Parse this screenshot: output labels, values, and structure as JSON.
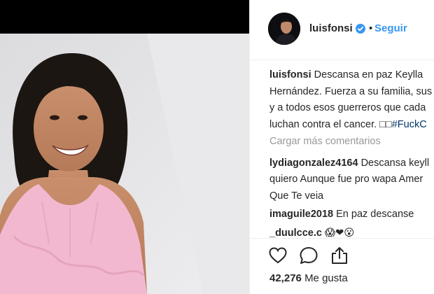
{
  "post": {
    "username": "luisfonsi",
    "follow_label": "Seguir",
    "separator": "•"
  },
  "caption": {
    "user": "luisfonsi",
    "lines": [
      "Descansa en paz Keylla",
      "Hernández. Fuerza a su familia, sus",
      "y a todos esos guerreros que cada",
      "luchan contra el cancer. □□",
      "#FuckC"
    ]
  },
  "load_more_label": "Cargar más comentarios",
  "comments": [
    {
      "user": "lydiagonzalez4164",
      "text_line1": "Descansa keyll",
      "text_line2": "quiero Aunque fue pro wapa Amer",
      "text_line3": "Que Te veia"
    },
    {
      "user": "imaguile2018",
      "text_line1": "En paz descanse"
    },
    {
      "user": "_duulcce.c",
      "text_line1": "😱❤😮"
    }
  ],
  "likes": {
    "count": "42,276",
    "label": "Me gusta"
  },
  "icons": {
    "verified": "verified-badge-icon",
    "like": "heart-icon",
    "comment": "comment-bubble-icon",
    "share": "share-upload-icon"
  },
  "colors": {
    "follow_blue": "#3897f0",
    "verified_blue": "#3897f0",
    "muted_gray": "#999999",
    "hashtag": "#003569",
    "photo_top_bar": "#000000",
    "photo_background": "#e6e6e8",
    "dress_pink": "#f2b8cf"
  }
}
